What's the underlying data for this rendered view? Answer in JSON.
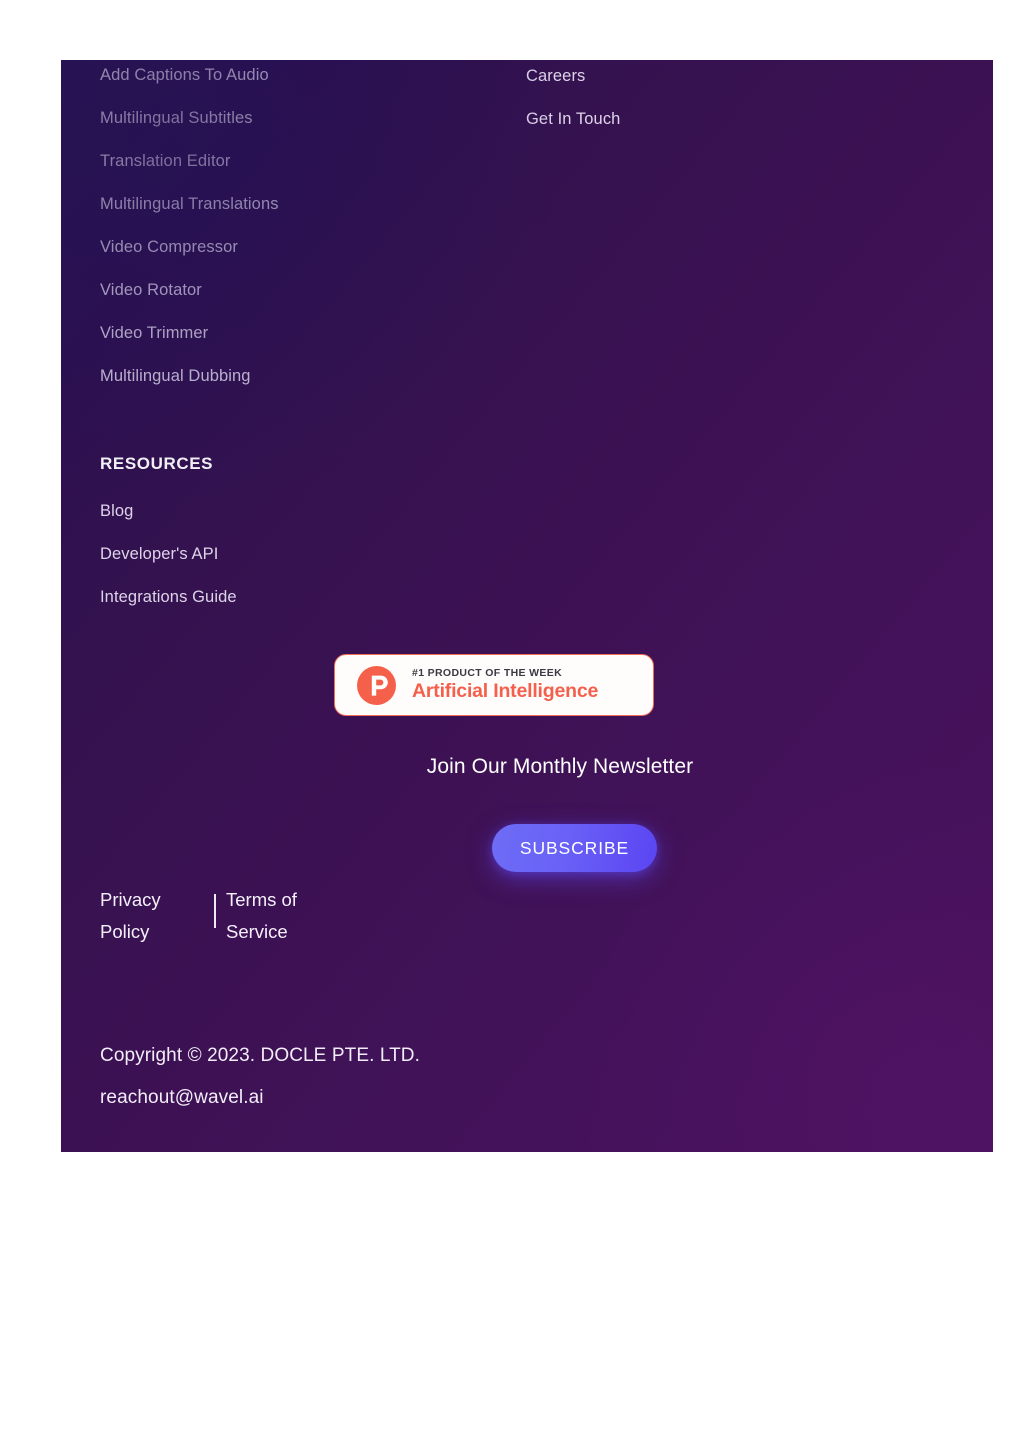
{
  "footer": {
    "products": {
      "links": [
        "Add Captions To Audio",
        "Multilingual Subtitles",
        "Translation Editor",
        "Multilingual Translations",
        "Video Compressor",
        "Video Rotator",
        "Video Trimmer",
        "Multilingual Dubbing"
      ]
    },
    "company": {
      "links": [
        "Careers",
        "Get In Touch"
      ]
    },
    "resources": {
      "title": "RESOURCES",
      "links": [
        "Blog",
        "Developer's API",
        "Integrations Guide"
      ]
    },
    "product_hunt_badge": {
      "logo_letter": "P",
      "kicker": "#1 PRODUCT OF THE WEEK",
      "name": "Artificial Intelligence",
      "accent_color": "#f5604a",
      "background_color": "#fffdfc"
    },
    "newsletter": {
      "title": "Join Our Monthly Newsletter",
      "subscribe_label": "SUBSCRIBE",
      "button_color": "#6257f5"
    },
    "legal": {
      "privacy_policy": "Privacy Policy",
      "separator": "|",
      "terms_of_service": "Terms of Service"
    },
    "copyright": {
      "line1": "Copyright © 2023. DOCLE PTE. LTD.",
      "email": "reachout@wavel.ai"
    },
    "background_color": "#3a1153"
  }
}
